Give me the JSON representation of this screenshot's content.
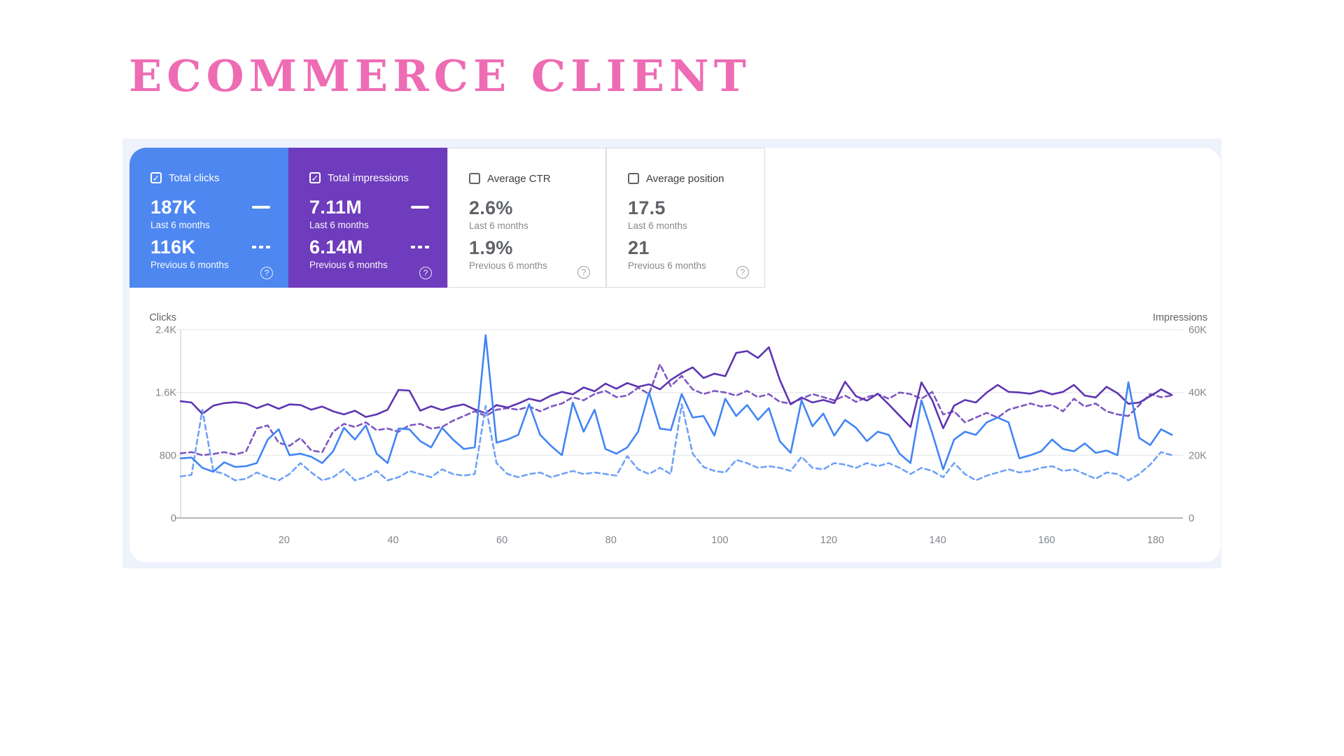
{
  "title": "ECOMMERCE CLIENT",
  "colors": {
    "title_pink": "#ee6cb4",
    "clicks_tile": "#4e87f0",
    "impressions_tile": "#6e3cbc",
    "panel_bg": "#eef2fc",
    "clicks_line": "#4285f4",
    "clicks_prev_line": "#6fa2f7",
    "impressions_line": "#5e35b1",
    "impressions_prev_line": "#7e57c2"
  },
  "cards": [
    {
      "label": "Total clicks",
      "checked": true,
      "value_current": "187K",
      "period_current": "Last 6 months",
      "value_previous": "116K",
      "period_previous": "Previous 6 months",
      "help": "?"
    },
    {
      "label": "Total impressions",
      "checked": true,
      "value_current": "7.11M",
      "period_current": "Last 6 months",
      "value_previous": "6.14M",
      "period_previous": "Previous 6 months",
      "help": "?"
    },
    {
      "label": "Average CTR",
      "checked": false,
      "value_current": "2.6%",
      "period_current": "Last 6 months",
      "value_previous": "1.9%",
      "period_previous": "Previous 6 months",
      "help": "?"
    },
    {
      "label": "Average position",
      "checked": false,
      "value_current": "17.5",
      "period_current": "Last 6 months",
      "value_previous": "21",
      "period_previous": "Previous 6 months",
      "help": "?"
    }
  ],
  "chart_data": {
    "type": "line",
    "x_day_start": 1,
    "x_day_step": 2,
    "x_day_max": 184,
    "x_tick_labels": [
      20,
      40,
      60,
      80,
      100,
      120,
      140,
      160,
      180
    ],
    "left_axis": {
      "title": "Clicks",
      "max": 2400,
      "ticks": [
        {
          "v": 0,
          "label": "0"
        },
        {
          "v": 800,
          "label": "800"
        },
        {
          "v": 1600,
          "label": "1.6K"
        },
        {
          "v": 2400,
          "label": "2.4K"
        }
      ]
    },
    "right_axis": {
      "title": "Impressions",
      "max": 60000,
      "ticks": [
        {
          "v": 0,
          "label": "0"
        },
        {
          "v": 20000,
          "label": "20K"
        },
        {
          "v": 40000,
          "label": "40K"
        },
        {
          "v": 60000,
          "label": "60K"
        }
      ]
    },
    "series": [
      {
        "name": "Impressions previous 6 months",
        "axis": "right",
        "dash": true,
        "color": "#7e57c2",
        "values": [
          20600,
          21000,
          20000,
          20400,
          21000,
          20200,
          21200,
          28500,
          29500,
          24000,
          23000,
          25500,
          21500,
          21000,
          27500,
          30000,
          29000,
          30500,
          28000,
          28500,
          27500,
          29500,
          30000,
          28500,
          29000,
          31000,
          32500,
          34000,
          32500,
          34500,
          35000,
          34500,
          35500,
          34000,
          35500,
          36500,
          38500,
          37500,
          39500,
          40500,
          38500,
          39000,
          41500,
          39500,
          49000,
          42000,
          45300,
          41000,
          39500,
          40500,
          40000,
          39000,
          40500,
          38500,
          39500,
          37000,
          36500,
          38000,
          39500,
          38500,
          37500,
          39000,
          37000,
          38500,
          39500,
          38000,
          40000,
          39500,
          38000,
          40200,
          33000,
          34000,
          30500,
          32000,
          33500,
          32000,
          34500,
          35500,
          36500,
          35500,
          36000,
          34000,
          38000,
          35500,
          36500,
          34000,
          33000,
          32500,
          36000,
          39500,
          38500,
          39000
        ]
      },
      {
        "name": "Impressions last 6 months",
        "axis": "right",
        "dash": false,
        "color": "#5e35b1",
        "values": [
          37200,
          36800,
          33200,
          35800,
          36600,
          36900,
          36500,
          35000,
          36300,
          34800,
          36200,
          36000,
          34500,
          35500,
          34000,
          33000,
          34200,
          32200,
          33000,
          34500,
          40800,
          40600,
          34200,
          35600,
          34400,
          35500,
          36200,
          34600,
          33400,
          36000,
          35200,
          36500,
          38000,
          37200,
          39000,
          40200,
          39400,
          41600,
          40400,
          42800,
          41200,
          43000,
          41800,
          42600,
          41000,
          44000,
          46200,
          48000,
          44600,
          46000,
          45200,
          52600,
          53200,
          51000,
          54400,
          44000,
          36200,
          38400,
          36800,
          37600,
          36600,
          43400,
          38800,
          37400,
          39600,
          36200,
          32600,
          29000,
          43200,
          37500,
          28600,
          35800,
          37600,
          36800,
          40000,
          42400,
          40200,
          40000,
          39600,
          40600,
          39400,
          40200,
          42400,
          39000,
          38400,
          41800,
          39800,
          36400,
          36800,
          38800,
          41000,
          39200
        ]
      },
      {
        "name": "Clicks previous 6 months",
        "axis": "left",
        "dash": true,
        "color": "#6fa2f7",
        "values": [
          530,
          550,
          1380,
          600,
          560,
          480,
          500,
          580,
          520,
          480,
          560,
          700,
          580,
          480,
          520,
          620,
          480,
          520,
          600,
          480,
          520,
          600,
          560,
          520,
          620,
          560,
          540,
          560,
          1430,
          700,
          560,
          520,
          560,
          580,
          520,
          560,
          600,
          560,
          580,
          560,
          540,
          790,
          620,
          560,
          640,
          560,
          1450,
          820,
          650,
          600,
          580,
          740,
          700,
          640,
          660,
          640,
          600,
          780,
          640,
          620,
          700,
          680,
          640,
          700,
          660,
          700,
          640,
          560,
          640,
          600,
          520,
          700,
          560,
          480,
          540,
          580,
          620,
          580,
          600,
          640,
          660,
          600,
          620,
          560,
          500,
          580,
          560,
          480,
          560,
          680,
          840,
          800
        ]
      },
      {
        "name": "Clicks last 6 months",
        "axis": "left",
        "dash": false,
        "color": "#4285f4",
        "values": [
          760,
          770,
          640,
          590,
          710,
          650,
          660,
          700,
          1000,
          1130,
          800,
          820,
          780,
          700,
          850,
          1150,
          1000,
          1180,
          820,
          700,
          1140,
          1130,
          980,
          900,
          1150,
          1000,
          880,
          900,
          2330,
          960,
          1000,
          1060,
          1450,
          1060,
          920,
          800,
          1470,
          1100,
          1380,
          880,
          820,
          900,
          1100,
          1600,
          1140,
          1120,
          1580,
          1280,
          1300,
          1050,
          1520,
          1300,
          1440,
          1250,
          1400,
          980,
          830,
          1500,
          1170,
          1330,
          1050,
          1250,
          1150,
          980,
          1100,
          1060,
          820,
          700,
          1500,
          1080,
          620,
          1000,
          1100,
          1060,
          1220,
          1280,
          1220,
          760,
          800,
          850,
          1000,
          880,
          850,
          950,
          830,
          860,
          800,
          1730,
          1020,
          930,
          1130,
          1060
        ]
      }
    ]
  }
}
